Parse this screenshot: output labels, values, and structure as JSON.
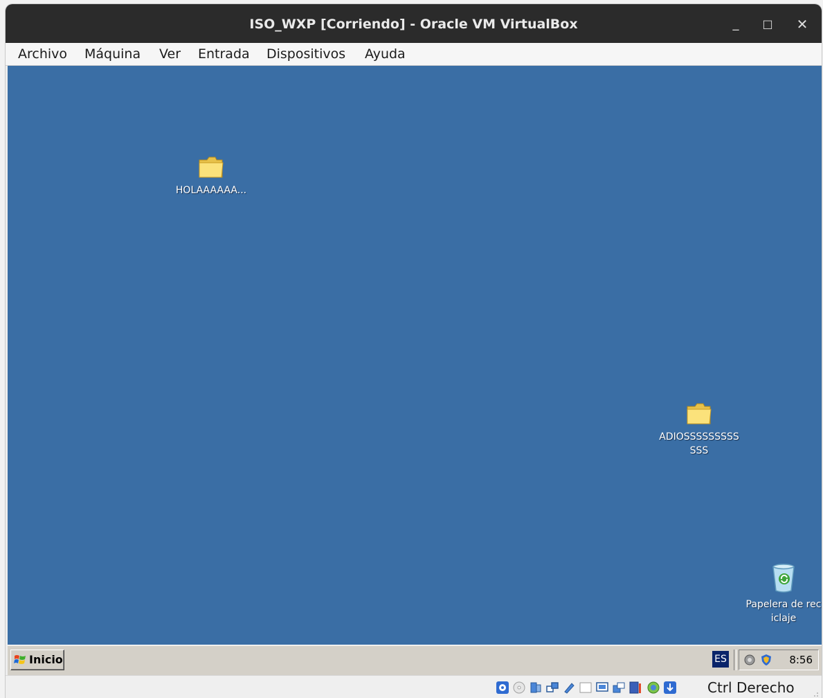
{
  "window": {
    "title": "ISO_WXP [Corriendo] - Oracle VM VirtualBox",
    "minimize": "_",
    "maximize": "□",
    "close": "✕"
  },
  "menu": {
    "items": [
      "Archivo",
      "Máquina",
      "Ver",
      "Entrada",
      "Dispositivos",
      "Ayuda"
    ]
  },
  "desktop": {
    "background": "#3a6ea5",
    "icons": [
      {
        "label": "HOLAAAAAA...",
        "icon": "folder-icon"
      },
      {
        "label": "ADIOSSSSSSSSSSSS",
        "icon": "folder-icon"
      },
      {
        "label": "Papelera de reciclaje",
        "icon": "recycle-bin-icon"
      }
    ]
  },
  "taskbar": {
    "start_label": "Inicio",
    "language": "ES",
    "clock": "8:56"
  },
  "statusbar": {
    "host_key": "Ctrl Derecho",
    "icons": [
      "hard-disk-icon",
      "optical-drive-icon",
      "audio-icon",
      "network-icon",
      "usb-icon",
      "shared-folders-icon",
      "display-icon",
      "video-capture-icon",
      "cpu-icon",
      "mouse-integration-icon",
      "keyboard-capture-icon"
    ]
  }
}
